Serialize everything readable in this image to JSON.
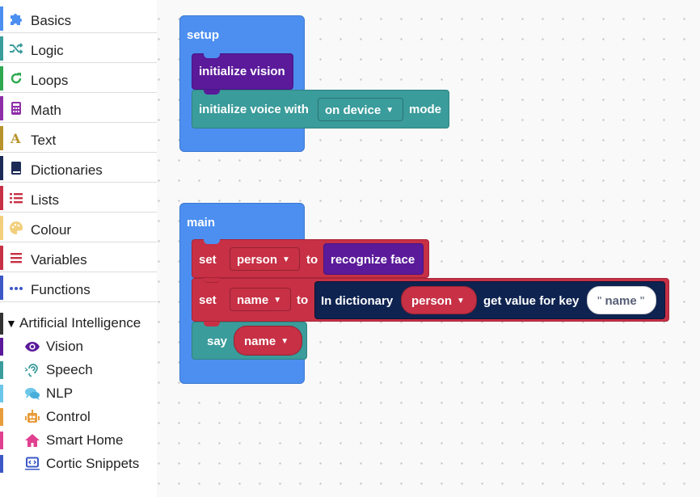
{
  "toolbox": {
    "categories": [
      {
        "label": "Basics",
        "color": "#4c8ff0",
        "icon": "puzzle-icon"
      },
      {
        "label": "Logic",
        "color": "#3a9c9b",
        "icon": "shuffle-icon"
      },
      {
        "label": "Loops",
        "color": "#2fa84f",
        "icon": "loop-arrow-icon"
      },
      {
        "label": "Math",
        "color": "#8d2ea8",
        "icon": "calculator-icon"
      },
      {
        "label": "Text",
        "color": "#b8932b",
        "icon": "text-a-icon"
      },
      {
        "label": "Dictionaries",
        "color": "#1b2b55",
        "icon": "book-icon"
      },
      {
        "label": "Lists",
        "color": "#c73045",
        "icon": "list-icon"
      },
      {
        "label": "Colour",
        "color": "#f2cf7c",
        "icon": "palette-icon"
      },
      {
        "label": "Variables",
        "color": "#c73045",
        "icon": "variables-icon"
      },
      {
        "label": "Functions",
        "color": "#3d57c6",
        "icon": "ellipsis-icon"
      }
    ],
    "ai_group": {
      "label": "Artificial Intelligence",
      "expanded_marker": "▼",
      "items": [
        {
          "label": "Vision",
          "color": "#5a1a9a",
          "icon": "eye-icon"
        },
        {
          "label": "Speech",
          "color": "#3a9c9b",
          "icon": "ear-icon"
        },
        {
          "label": "NLP",
          "color": "#6cc6ea",
          "icon": "chat-bubbles-icon"
        },
        {
          "label": "Control",
          "color": "#e99c3a",
          "icon": "robot-icon"
        },
        {
          "label": "Smart Home",
          "color": "#e0408f",
          "icon": "home-icon"
        },
        {
          "label": "Cortic Snippets",
          "color": "#3d57c6",
          "icon": "code-window-icon"
        }
      ]
    }
  },
  "blocks": {
    "setup": {
      "label": "setup",
      "init_vision": "initialize vision",
      "init_voice": {
        "prefix": "initialize voice with",
        "option": "on device",
        "suffix": "mode"
      }
    },
    "main": {
      "label": "main",
      "set1": {
        "set": "set",
        "var": "person",
        "to": "to",
        "value": "recognize face"
      },
      "set2": {
        "set": "set",
        "var": "name",
        "to": "to",
        "in_dict": "In dictionary",
        "dict_var": "person",
        "get_key": "get value for key",
        "key": "name"
      },
      "say": {
        "say": "say",
        "var": "name"
      }
    }
  },
  "colors": {
    "hat_blue": "#4c8ff0",
    "vision_purple": "#5a1a9a",
    "speech_teal": "#3a9c9b",
    "variable_red": "#c73045",
    "dict_navy": "#0e2350"
  }
}
